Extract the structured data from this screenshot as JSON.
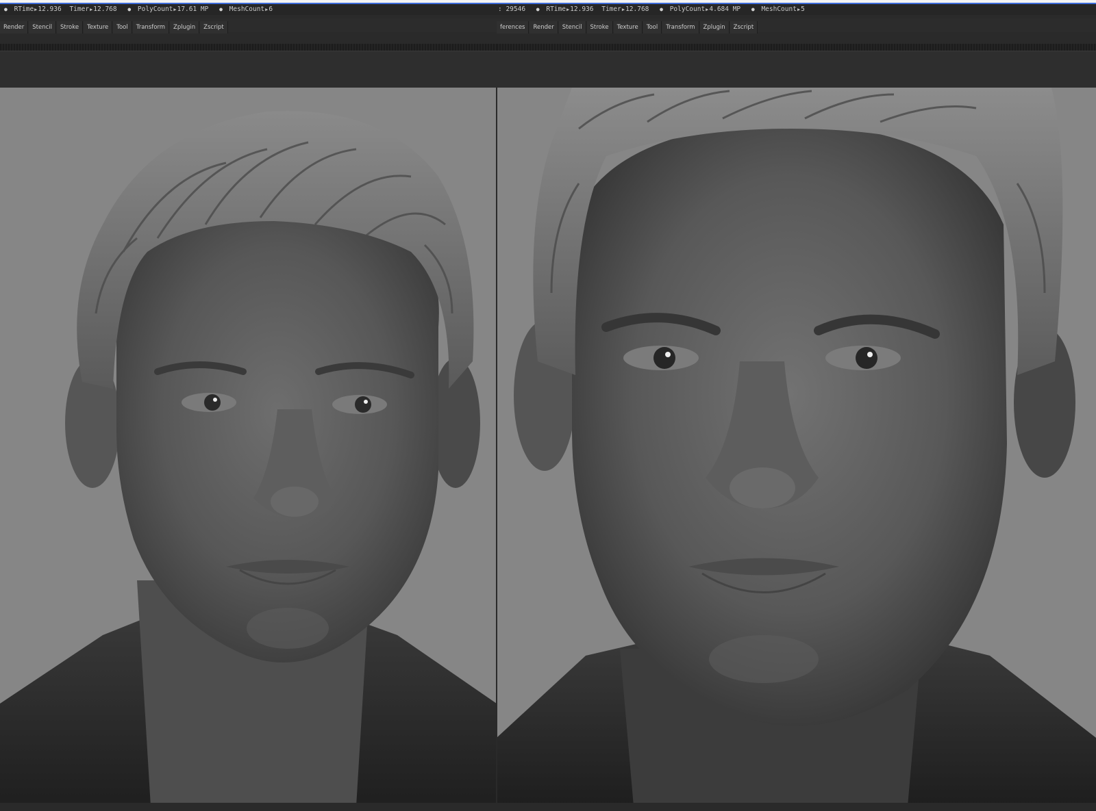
{
  "left_panel": {
    "status": {
      "rtime_label": "RTime",
      "rtime_value": "12.936",
      "timer_label": "Timer",
      "timer_value": "12.768",
      "polycount_label": "PolyCount",
      "polycount_value": "17.61 MP",
      "meshcount_label": "MeshCount",
      "meshcount_value": "6"
    },
    "menu": [
      "Render",
      "Stencil",
      "Stroke",
      "Texture",
      "Tool",
      "Transform",
      "Zplugin",
      "Zscript"
    ]
  },
  "right_panel": {
    "status": {
      "prefix_value": ": 29546",
      "rtime_label": "RTime",
      "rtime_value": "12.936",
      "timer_label": "Timer",
      "timer_value": "12.768",
      "polycount_label": "PolyCount",
      "polycount_value": "4.684 MP",
      "meshcount_label": "MeshCount",
      "meshcount_value": "5"
    },
    "menu": [
      "ferences",
      "Render",
      "Stencil",
      "Stroke",
      "Texture",
      "Tool",
      "Transform",
      "Zplugin",
      "Zscript"
    ]
  },
  "colors": {
    "ui_background": "#2a2a2a",
    "viewport_background": "#868686",
    "sculpt_clay": "#5a5a5a",
    "accent_line": "#3d6bd9"
  }
}
